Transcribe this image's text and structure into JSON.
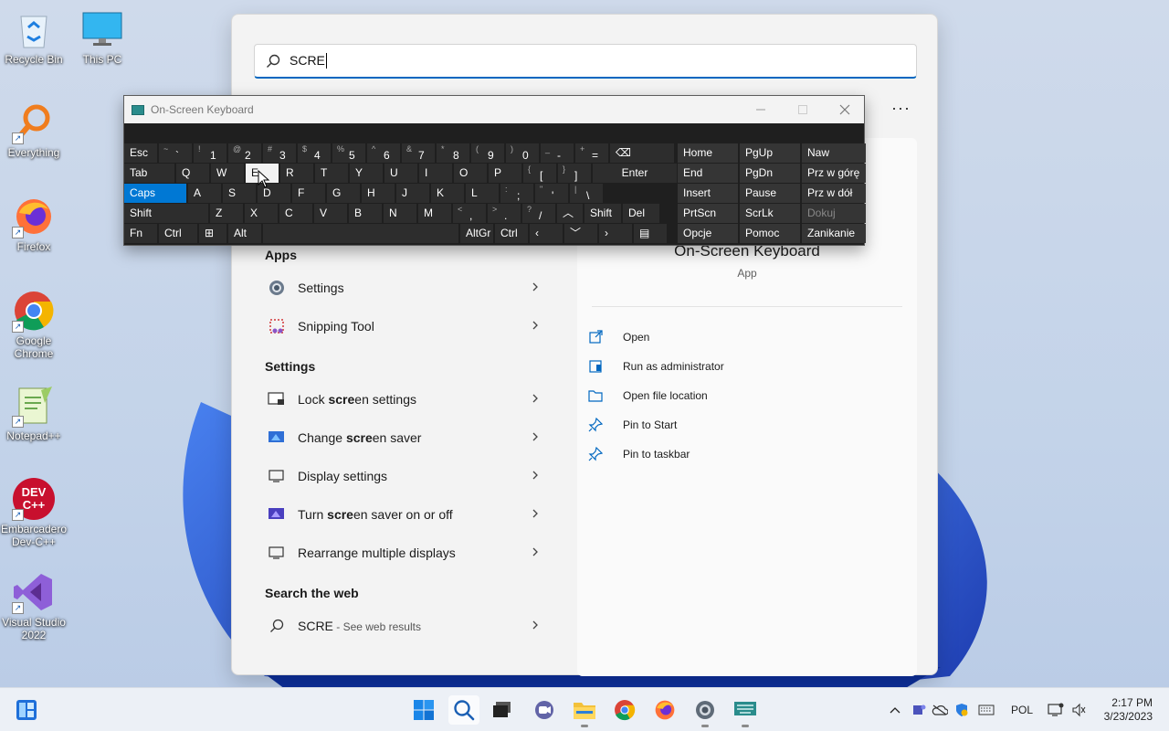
{
  "desktop": {
    "icons": [
      {
        "label": "Recycle Bin",
        "icon": "recycle-bin-icon"
      },
      {
        "label": "This PC",
        "icon": "monitor-icon"
      },
      {
        "label": "Everything",
        "icon": "magnifier-icon"
      },
      {
        "label": "Firefox",
        "icon": "firefox-icon"
      },
      {
        "label": "Google Chrome",
        "icon": "chrome-icon"
      },
      {
        "label": "Notepad++",
        "icon": "notepadpp-icon"
      },
      {
        "label": "Embarcadero Dev-C++",
        "icon": "devcpp-icon",
        "badge": "DEV C++"
      },
      {
        "label": "Visual Studio 2022",
        "icon": "visual-studio-icon"
      }
    ]
  },
  "search": {
    "query": "SCRE",
    "more": "···",
    "sections": {
      "apps": "Apps",
      "settings": "Settings",
      "web": "Search the web"
    },
    "apps": [
      {
        "label": "Settings",
        "icon": "gear-icon"
      },
      {
        "label": "Snipping Tool",
        "icon": "snipping-tool-icon"
      }
    ],
    "settings": [
      {
        "pre": "Lock ",
        "match": "scre",
        "post": "en settings",
        "icon": "lock-screen-icon"
      },
      {
        "pre": "Change ",
        "match": "scre",
        "post": "en saver",
        "icon": "screen-saver-icon"
      },
      {
        "pre": "Display settings",
        "match": "",
        "post": "",
        "icon": "display-icon"
      },
      {
        "pre": "Turn ",
        "match": "scre",
        "post": "en saver on or off",
        "icon": "screen-saver-toggle-icon"
      },
      {
        "pre": "Rearrange multiple displays",
        "match": "",
        "post": "",
        "icon": "displays-icon"
      }
    ],
    "web": {
      "query": "SCRE",
      "suffix": " - See web results"
    }
  },
  "detail": {
    "app_name": "On-Screen Keyboard",
    "app_type": "App",
    "actions": [
      {
        "label": "Open",
        "icon": "open-icon"
      },
      {
        "label": "Run as administrator",
        "icon": "shield-admin-icon"
      },
      {
        "label": "Open file location",
        "icon": "folder-icon"
      },
      {
        "label": "Pin to Start",
        "icon": "pin-icon"
      },
      {
        "label": "Pin to taskbar",
        "icon": "pin-taskbar-icon"
      }
    ]
  },
  "osk": {
    "title": "On-Screen Keyboard",
    "rows": [
      [
        {
          "m": "Esc",
          "w": 36,
          "plain": true
        },
        {
          "s": "~",
          "m": "`",
          "w": 36
        },
        {
          "s": "!",
          "m": "1",
          "w": 36
        },
        {
          "s": "@",
          "m": "2",
          "w": 36
        },
        {
          "s": "#",
          "m": "3",
          "w": 36
        },
        {
          "s": "$",
          "m": "4",
          "w": 36
        },
        {
          "s": "%",
          "m": "5",
          "w": 36
        },
        {
          "s": "^",
          "m": "6",
          "w": 36
        },
        {
          "s": "&",
          "m": "7",
          "w": 36
        },
        {
          "s": "*",
          "m": "8",
          "w": 36
        },
        {
          "s": "(",
          "m": "9",
          "w": 36
        },
        {
          "s": ")",
          "m": "0",
          "w": 36
        },
        {
          "s": "_",
          "m": "-",
          "w": 36
        },
        {
          "s": "+",
          "m": "=",
          "w": 36
        },
        {
          "m": "⌫",
          "w": 70,
          "plain": true
        }
      ],
      [
        {
          "m": "Tab",
          "w": 55,
          "plain": true
        },
        {
          "m": "Q",
          "w": 36,
          "plain": true
        },
        {
          "m": "W",
          "w": 36,
          "plain": true
        },
        {
          "m": "E",
          "w": 36,
          "plain": true,
          "hl": true
        },
        {
          "m": "R",
          "w": 36,
          "plain": true
        },
        {
          "m": "T",
          "w": 36,
          "plain": true
        },
        {
          "m": "Y",
          "w": 36,
          "plain": true
        },
        {
          "m": "U",
          "w": 36,
          "plain": true
        },
        {
          "m": "I",
          "w": 36,
          "plain": true
        },
        {
          "m": "O",
          "w": 36,
          "plain": true
        },
        {
          "m": "P",
          "w": 36,
          "plain": true
        },
        {
          "s": "{",
          "m": "[",
          "w": 36
        },
        {
          "s": "}",
          "m": "]",
          "w": 36
        },
        {
          "m": "Enter",
          "w": 92,
          "plain": true,
          "center": true
        }
      ],
      [
        {
          "m": "Caps",
          "w": 68,
          "plain": true,
          "blue": true
        },
        {
          "m": "A",
          "w": 36,
          "plain": true
        },
        {
          "m": "S",
          "w": 36,
          "plain": true
        },
        {
          "m": "D",
          "w": 36,
          "plain": true
        },
        {
          "m": "F",
          "w": 36,
          "plain": true
        },
        {
          "m": "G",
          "w": 36,
          "plain": true
        },
        {
          "m": "H",
          "w": 36,
          "plain": true
        },
        {
          "m": "J",
          "w": 36,
          "plain": true
        },
        {
          "m": "K",
          "w": 36,
          "plain": true
        },
        {
          "m": "L",
          "w": 36,
          "plain": true
        },
        {
          "s": ":",
          "m": ";",
          "w": 36
        },
        {
          "s": "\"",
          "m": "'",
          "w": 36
        },
        {
          "s": "|",
          "m": "\\",
          "w": 36
        }
      ],
      [
        {
          "m": "Shift",
          "w": 92,
          "plain": true
        },
        {
          "m": "Z",
          "w": 36,
          "plain": true
        },
        {
          "m": "X",
          "w": 36,
          "plain": true
        },
        {
          "m": "C",
          "w": 36,
          "plain": true
        },
        {
          "m": "V",
          "w": 36,
          "plain": true
        },
        {
          "m": "B",
          "w": 36,
          "plain": true
        },
        {
          "m": "N",
          "w": 36,
          "plain": true
        },
        {
          "m": "M",
          "w": 36,
          "plain": true
        },
        {
          "s": "<",
          "m": ",",
          "w": 36
        },
        {
          "s": ">",
          "m": ".",
          "w": 36
        },
        {
          "s": "?",
          "m": "/",
          "w": 36
        },
        {
          "m": "︿",
          "w": 28,
          "plain": true
        },
        {
          "m": "Shift",
          "w": 40,
          "plain": true
        },
        {
          "m": "Del",
          "w": 40,
          "plain": true
        }
      ],
      [
        {
          "m": "Fn",
          "w": 36,
          "plain": true
        },
        {
          "m": "Ctrl",
          "w": 42,
          "plain": true
        },
        {
          "m": "⊞",
          "w": 30,
          "plain": true
        },
        {
          "m": "Alt",
          "w": 36,
          "plain": true
        },
        {
          "m": "",
          "w": 214,
          "plain": true
        },
        {
          "m": "AltGr",
          "w": 36,
          "plain": true
        },
        {
          "m": "Ctrl",
          "w": 36,
          "plain": true
        },
        {
          "m": "‹",
          "w": 36,
          "plain": true
        },
        {
          "m": "﹀",
          "w": 36,
          "plain": true
        },
        {
          "m": "›",
          "w": 36,
          "plain": true
        },
        {
          "m": "▤",
          "w": 36,
          "plain": true
        }
      ]
    ],
    "nav": [
      [
        {
          "m": "Home"
        },
        {
          "m": "PgUp"
        },
        {
          "m": "Naw"
        }
      ],
      [
        {
          "m": "End"
        },
        {
          "m": "PgDn"
        },
        {
          "m": "Prz w górę"
        }
      ],
      [
        {
          "m": "Insert"
        },
        {
          "m": "Pause"
        },
        {
          "m": "Prz w dół"
        }
      ],
      [
        {
          "m": "PrtScn"
        },
        {
          "m": "ScrLk"
        },
        {
          "m": "Dokuj",
          "dim": true
        }
      ],
      [
        {
          "m": "Opcje"
        },
        {
          "m": "Pomoc"
        },
        {
          "m": "Zanikanie"
        }
      ]
    ]
  },
  "taskbar": {
    "apps": [
      "start-icon",
      "search-icon",
      "task-view-icon",
      "chat-icon",
      "file-explorer-icon",
      "chrome-icon",
      "firefox-icon",
      "settings-icon",
      "on-screen-keyboard-icon"
    ],
    "tray_lang": "POL",
    "time": "2:17 PM",
    "date": "3/23/2023"
  }
}
